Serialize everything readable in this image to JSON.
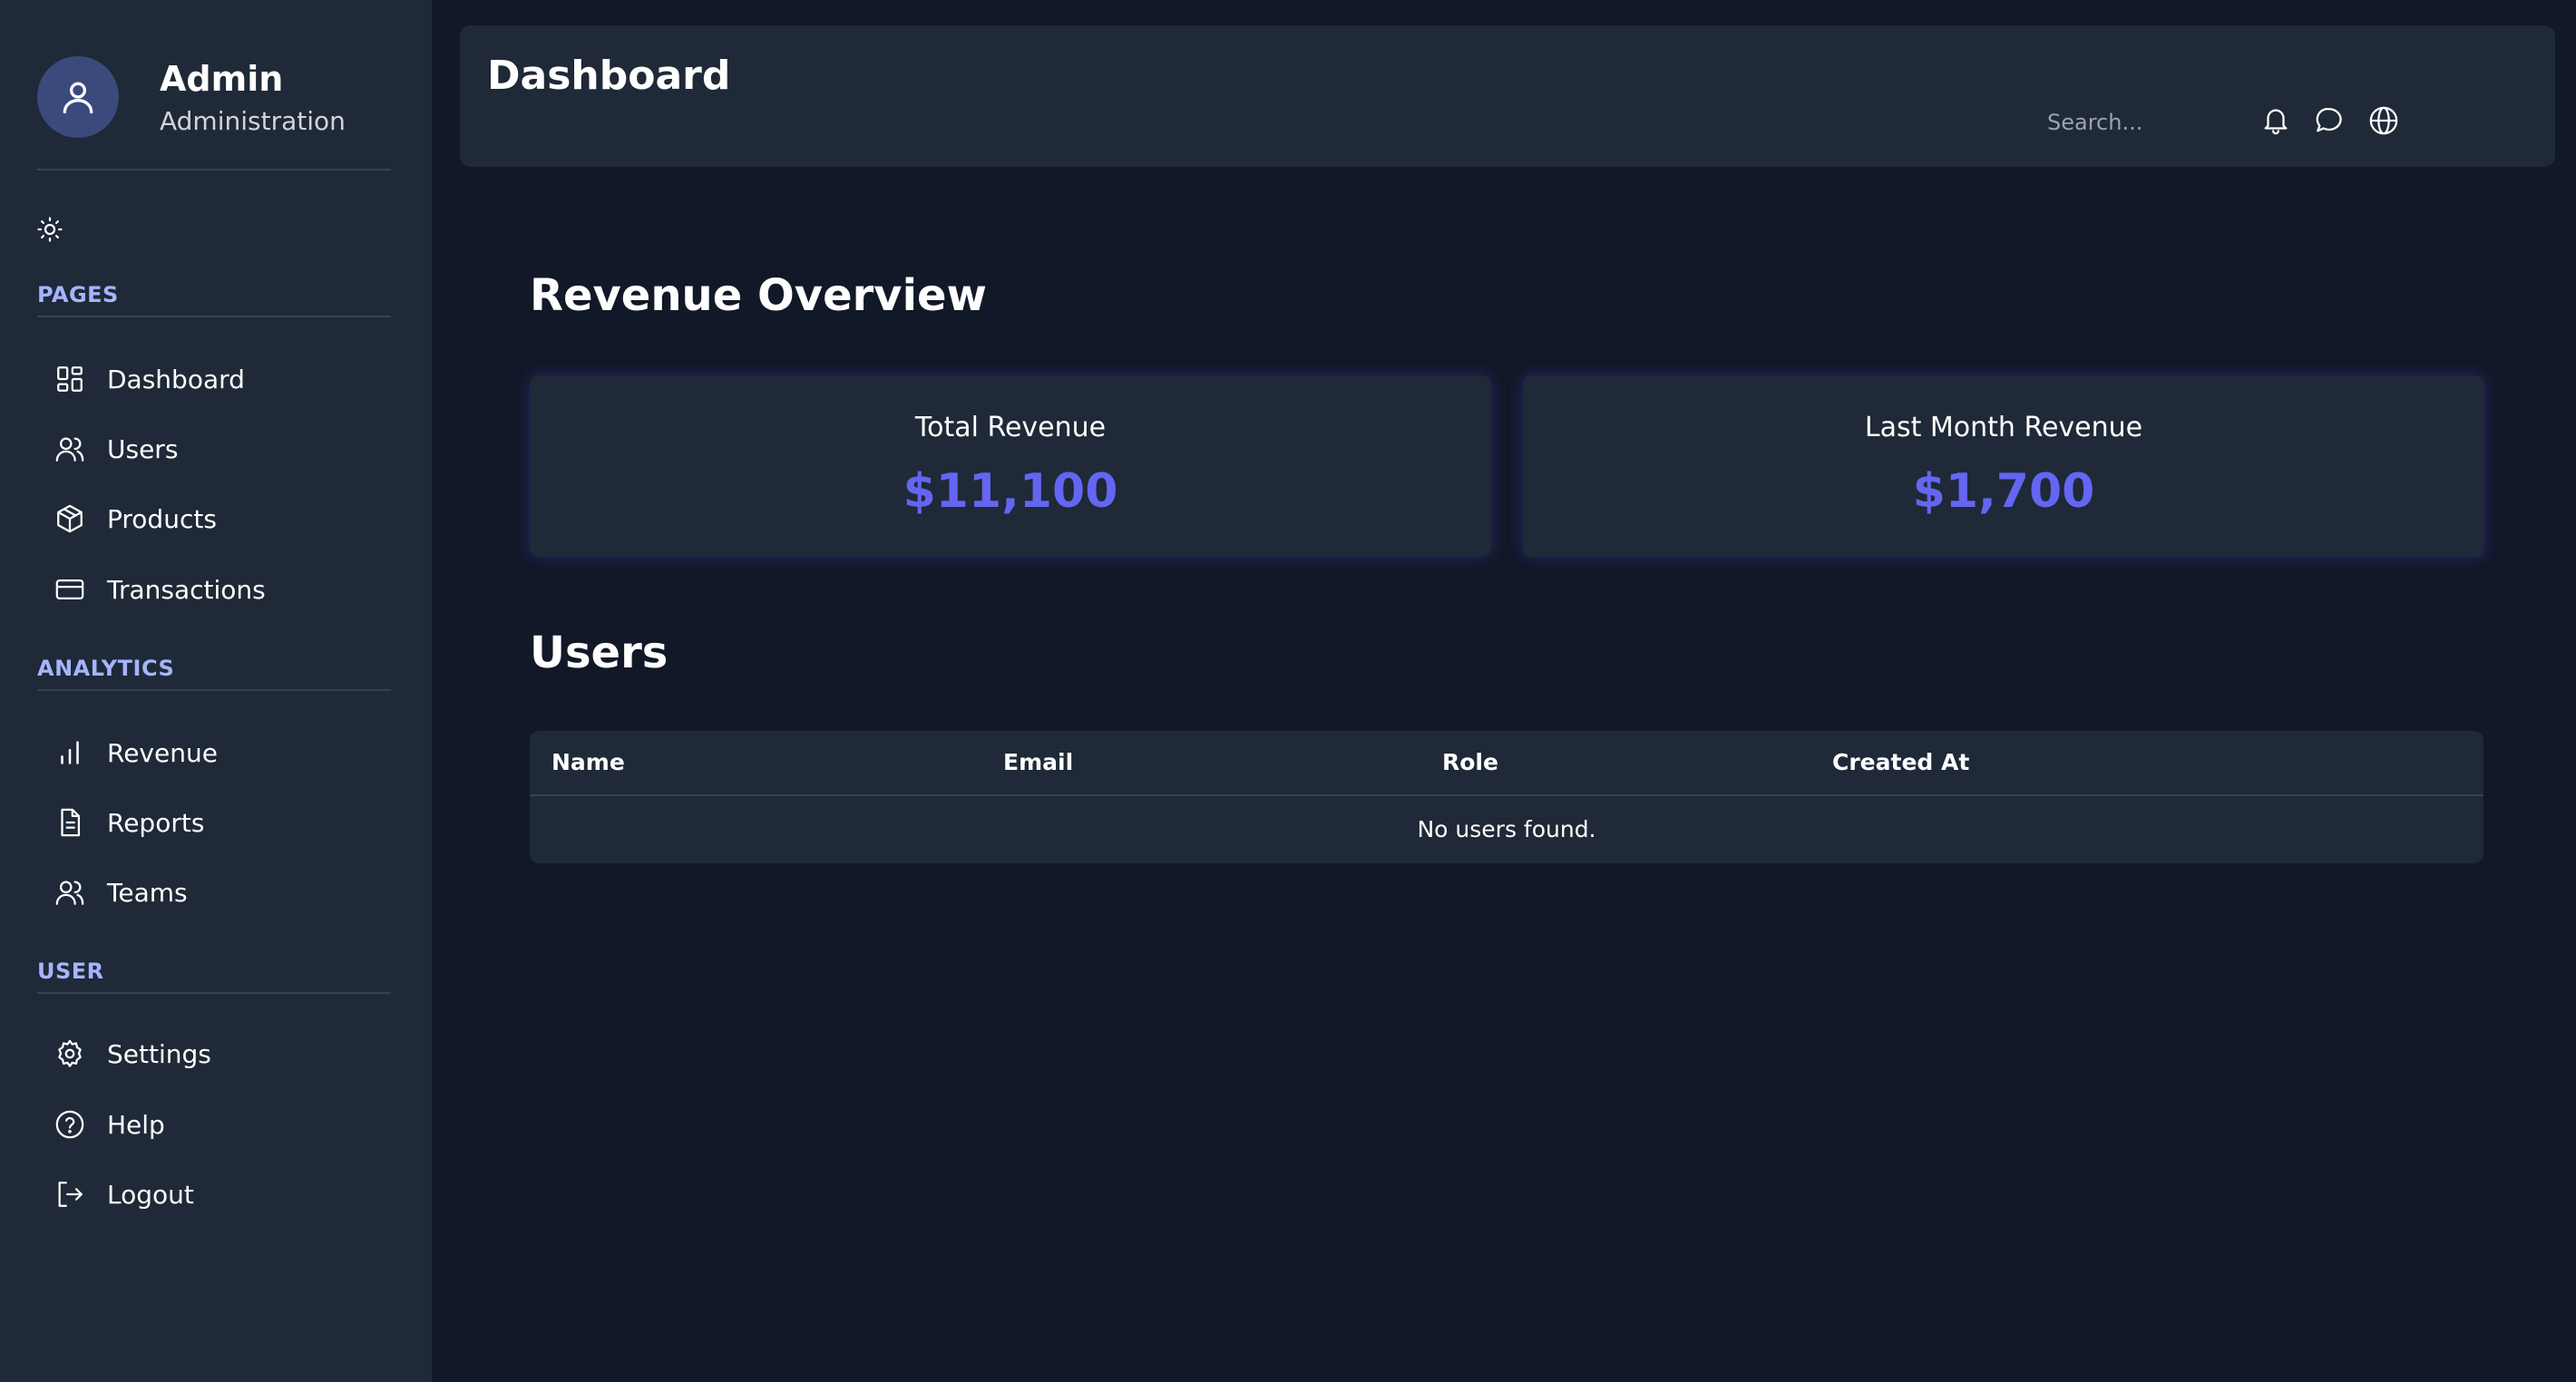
{
  "profile": {
    "name": "Admin",
    "role": "Administration"
  },
  "sidebar": {
    "sections": [
      {
        "label": "PAGES",
        "items": [
          {
            "label": "Dashboard",
            "icon": "dashboard-icon"
          },
          {
            "label": "Users",
            "icon": "users-icon"
          },
          {
            "label": "Products",
            "icon": "box-icon"
          },
          {
            "label": "Transactions",
            "icon": "credit-card-icon"
          }
        ]
      },
      {
        "label": "ANALYTICS",
        "items": [
          {
            "label": "Revenue",
            "icon": "bar-chart-icon"
          },
          {
            "label": "Reports",
            "icon": "document-icon"
          },
          {
            "label": "Teams",
            "icon": "users-icon"
          }
        ]
      },
      {
        "label": "USER",
        "items": [
          {
            "label": "Settings",
            "icon": "gear-icon"
          },
          {
            "label": "Help",
            "icon": "help-circle-icon"
          },
          {
            "label": "Logout",
            "icon": "logout-icon"
          }
        ]
      }
    ]
  },
  "header": {
    "title": "Dashboard",
    "search_placeholder": "Search...",
    "icons": [
      "bell-icon",
      "message-icon",
      "globe-icon"
    ]
  },
  "revenue": {
    "title": "Revenue Overview",
    "cards": [
      {
        "label": "Total Revenue",
        "value": "$11,100"
      },
      {
        "label": "Last Month Revenue",
        "value": "$1,700"
      }
    ]
  },
  "users": {
    "title": "Users",
    "columns": [
      "Name",
      "Email",
      "Role",
      "Created At"
    ],
    "empty_message": "No users found."
  },
  "colors": {
    "background": "#111827",
    "panel": "#1f2937",
    "accent": "#6366f1",
    "section_label": "#a5b4fc"
  }
}
